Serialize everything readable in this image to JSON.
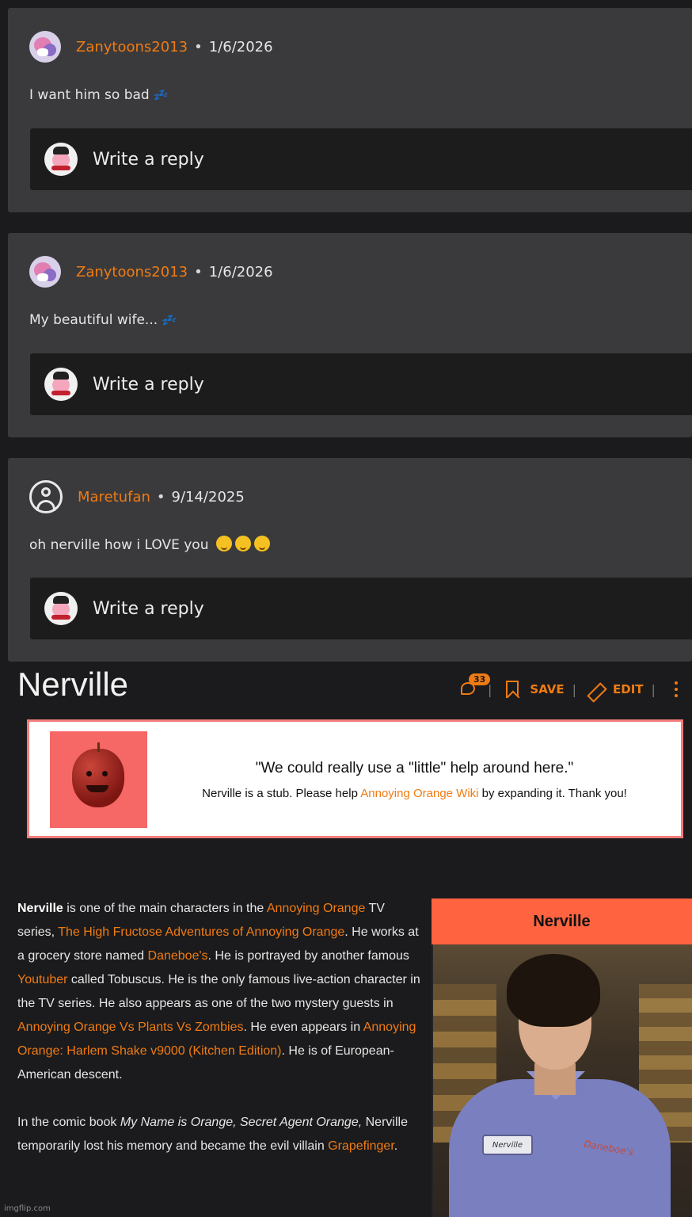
{
  "comments": [
    {
      "username": "Zanytoons2013",
      "date": "1/6/2026",
      "text": "I want him so bad",
      "emoji": "💤",
      "reply_placeholder": "Write a reply"
    },
    {
      "username": "Zanytoons2013",
      "date": "1/6/2026",
      "text": "My beautiful wife...",
      "emoji": "💤",
      "reply_placeholder": "Write a reply"
    },
    {
      "username": "Maretufan",
      "date": "9/14/2025",
      "text": "oh nerville how i LOVE you",
      "emoji": "🤤🤤🤤",
      "reply_placeholder": "Write a reply"
    }
  ],
  "article": {
    "title": "Nerville",
    "comment_count": "33",
    "save_label": "SAVE",
    "edit_label": "EDIT",
    "stub": {
      "quote": "\"We could really use a \"little\" help around here.\"",
      "text_before": "Nerville is a stub. Please help ",
      "link": "Annoying Orange Wiki",
      "text_after": " by expanding it. Thank you!"
    },
    "paragraph1": {
      "name": "Nerville",
      "t1": " is one of the main characters in the ",
      "l1": "Annoying Orange",
      "t2": " TV series, ",
      "l2": "The High Fructose Adventures of Annoying Orange",
      "t3": ". He works at a grocery store named ",
      "l3": "Daneboe's",
      "t4": ". He is portrayed by another famous ",
      "l4": "Youtuber",
      "t5": " called Tobuscus. He is the only famous live-action character in the TV series. He also appears as one of the two mystery guests in ",
      "l5": "Annoying Orange Vs Plants Vs Zombies",
      "t6": ". He even appears in ",
      "l6": "Annoying Orange: Harlem Shake v9000 (Kitchen Edition)",
      "t7": ". He is of European-American descent."
    },
    "paragraph2": {
      "t1": "In the comic book ",
      "italic": "My Name is Orange, Secret Agent Orange,",
      "t2": " Nerville temporarily lost his memory and became the evil villain ",
      "l1": "Grapefinger",
      "t3": "."
    },
    "infobox": {
      "title": "Nerville",
      "nametag": "Nerville",
      "patch": "Daneboe's"
    }
  },
  "watermark": "imgflip.com",
  "colors": {
    "accent": "#f07b13",
    "card_bg": "#3a3a3c",
    "reply_bg": "#1c1c1d",
    "page_bg": "#1b1b1d",
    "infobox_header": "#ff6340",
    "stub_border": "#f47d7b"
  }
}
